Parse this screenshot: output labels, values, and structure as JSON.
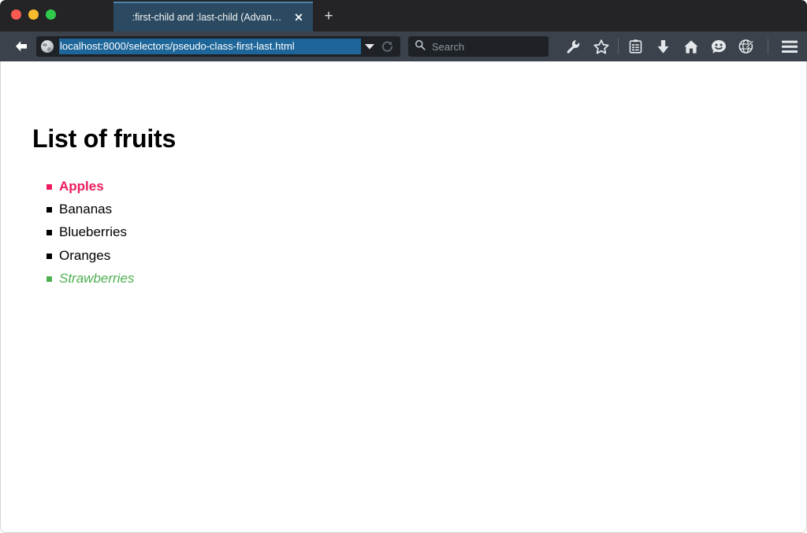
{
  "window": {
    "traffic_lights": [
      {
        "name": "close",
        "color": "#F85A52"
      },
      {
        "name": "minimize",
        "color": "#F9BC2E"
      },
      {
        "name": "zoom",
        "color": "#2FC94C"
      }
    ]
  },
  "tabs": {
    "active": {
      "title": ":first-child and :last-child (Advan…",
      "close_label": "✕",
      "favicon": "globe-icon"
    },
    "new_tab_label": "+"
  },
  "toolbar": {
    "back_label": "Back",
    "url": "localhost:8000/selectors/pseudo-class-first-last.html",
    "url_selected": true,
    "dropdown_icon": "chevron-down-icon",
    "reload_icon": "reload-icon",
    "search": {
      "placeholder": "Search",
      "value": "",
      "icon": "search-icon"
    },
    "icons": [
      {
        "name": "wrench-icon",
        "label": "Developer Tools"
      },
      {
        "name": "star-icon",
        "label": "Bookmark"
      },
      {
        "name": "reader-icon",
        "label": "Reader View"
      },
      {
        "name": "download-icon",
        "label": "Downloads"
      },
      {
        "name": "home-icon",
        "label": "Home"
      },
      {
        "name": "smiley-icon",
        "label": "Feedback"
      },
      {
        "name": "globe-pencil-icon",
        "label": "Annotate"
      },
      {
        "name": "hamburger-menu-icon",
        "label": "Menu"
      }
    ]
  },
  "page": {
    "heading": "List of fruits",
    "list": [
      {
        "text": "Apples",
        "style": "first",
        "color": "#EC1C5E"
      },
      {
        "text": "Bananas",
        "style": "normal",
        "color": "#000000"
      },
      {
        "text": "Blueberries",
        "style": "normal",
        "color": "#000000"
      },
      {
        "text": "Oranges",
        "style": "normal",
        "color": "#000000"
      },
      {
        "text": "Strawberries",
        "style": "last",
        "color": "#4CAF50"
      }
    ]
  },
  "colors": {
    "titlebar": "#242426",
    "toolbar": "#3B424C",
    "tab_active": "#2B4A61",
    "tab_accent": "#4C86AD",
    "url_field": "#1E2227",
    "url_selection": "#1E6699",
    "page_bg": "#FFFFFF",
    "first_child": "#EC1C5E",
    "last_child": "#4CAF50"
  }
}
